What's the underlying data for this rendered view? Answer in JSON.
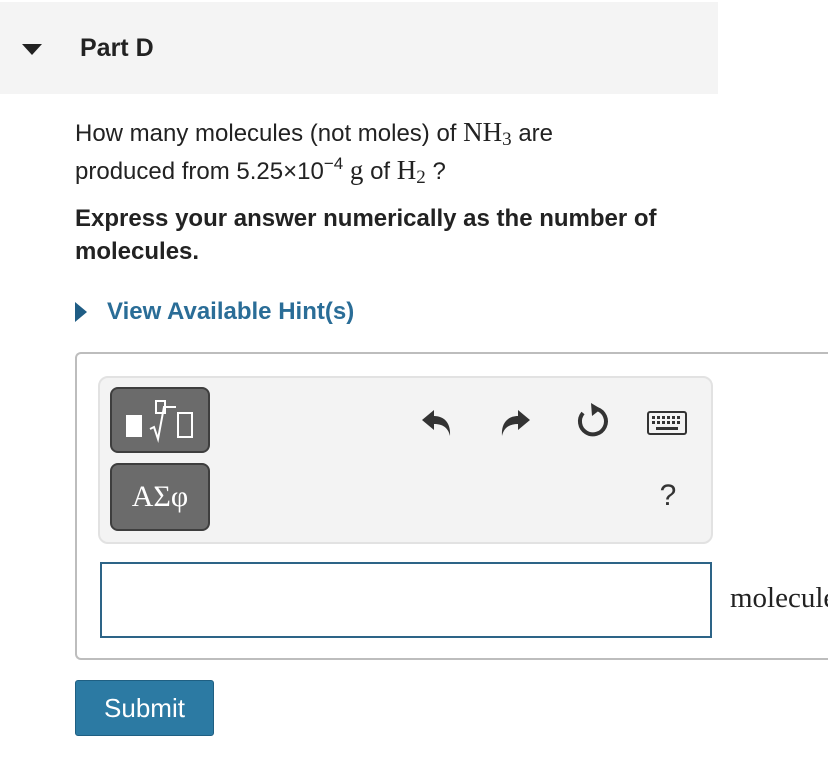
{
  "part": {
    "title": "Part D"
  },
  "question": {
    "text_before": "How many molecules (not moles) of",
    "compound1_base": "NH",
    "compound1_sub": "3",
    "text_middle1": "are",
    "text_middle2": "produced from 5.25×10",
    "exponent": "−4",
    "unit_g": "g",
    "text_of": "of",
    "compound2_base": "H",
    "compound2_sub": "2",
    "text_end": "?"
  },
  "instruction": "Express your answer numerically as the number of molecules.",
  "hint": {
    "label": "View Available Hint(s)"
  },
  "toolbar": {
    "greek_label": "ΑΣφ",
    "help_label": "?"
  },
  "answer": {
    "value": "",
    "units": "molecules"
  },
  "submit_label": "Submit",
  "colors": {
    "accent": "#2c7aa3",
    "link": "#2a6d97",
    "tool_button": "#6b6b6b"
  }
}
